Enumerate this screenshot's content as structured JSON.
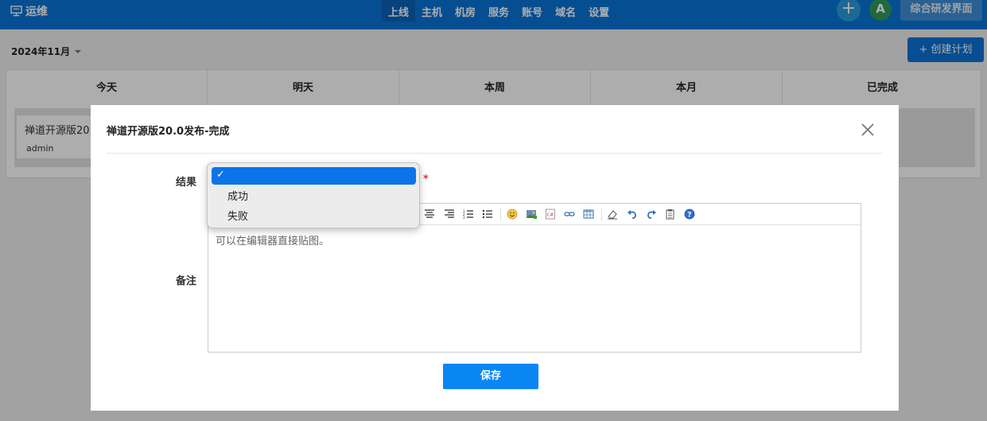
{
  "app": {
    "name": "运维"
  },
  "nav": {
    "items": [
      {
        "label": "上线",
        "active": true
      },
      {
        "label": "主机",
        "active": false
      },
      {
        "label": "机房",
        "active": false
      },
      {
        "label": "服务",
        "active": false
      },
      {
        "label": "账号",
        "active": false
      },
      {
        "label": "域名",
        "active": false
      },
      {
        "label": "设置",
        "active": false
      }
    ],
    "avatar_letter": "A",
    "switch_label": "综合研发界面"
  },
  "page": {
    "date_label": "2024年11月",
    "create_label": "+ 创建计划",
    "columns": [
      "今天",
      "明天",
      "本周",
      "本月",
      "已完成"
    ],
    "card": {
      "title": "禅道开源版20",
      "user": "admin"
    }
  },
  "modal": {
    "title": "禅道开源版20.0发布-完成",
    "result_label": "结果",
    "required_mark": "*",
    "note_label": "备注",
    "editor_placeholder": "可以在编辑器直接贴图。",
    "save_label": "保存"
  },
  "select_popup": {
    "selected_mark": "✓",
    "options": [
      "成功",
      "失败"
    ]
  },
  "colors": {
    "topbar": "#0a74d8",
    "primary_button": "#0a86f4",
    "selected_option": "#0a74e8"
  }
}
